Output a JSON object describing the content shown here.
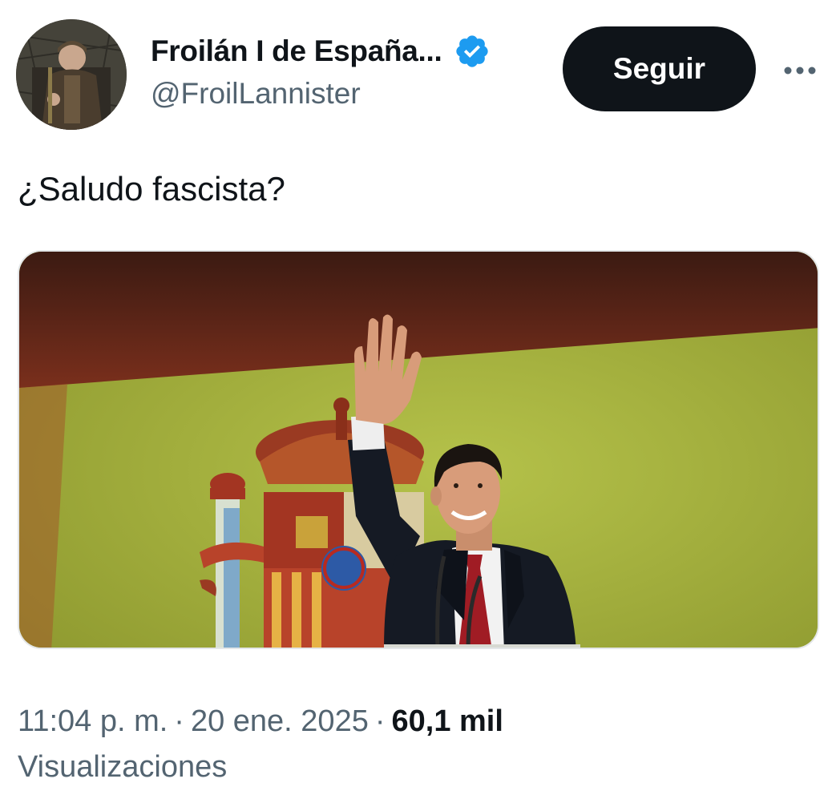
{
  "author": {
    "display_name": "Froilán I de España...",
    "handle": "@FroilLannister",
    "verified_icon": "verified-badge-icon",
    "avatar_icon": "avatar-image"
  },
  "actions": {
    "follow_label": "Seguir",
    "more_icon": "more-options-icon"
  },
  "tweet": {
    "text": "¿Saludo fascista?"
  },
  "media": {
    "icon": "tweet-photo"
  },
  "meta": {
    "time": "11:04 p. m.",
    "separator": "·",
    "date": "20 ene. 2025",
    "views_count": "60,1 mil",
    "views_label": "Visualizaciones"
  },
  "colors": {
    "text_primary": "#0f1419",
    "text_secondary": "#536471",
    "verified_blue": "#1d9bf0",
    "button_bg": "#0f1419",
    "button_text": "#ffffff"
  }
}
